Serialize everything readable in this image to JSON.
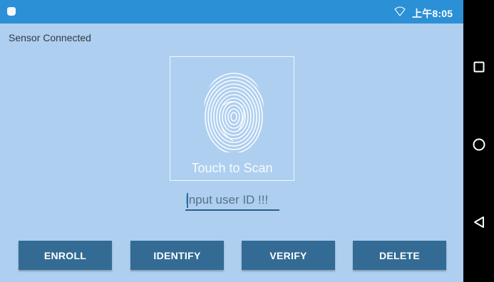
{
  "status_bar": {
    "time": "上午8:05",
    "icons": [
      "android-icon",
      "wifi-icon"
    ],
    "background": "#2b90d6"
  },
  "app": {
    "sensor_status": "Sensor Connected",
    "scan_prompt": "Touch to Scan",
    "user_id_input": {
      "value": "",
      "placeholder": "Input user ID !!!"
    },
    "background": "#aecfef"
  },
  "buttons": {
    "enroll": "ENROLL",
    "identify": "IDENTIFY",
    "verify": "VERIFY",
    "delete": "DELETE",
    "color": "#336b94"
  },
  "nav_bar": {
    "icons": [
      "recents-icon",
      "home-icon",
      "back-icon"
    ]
  }
}
